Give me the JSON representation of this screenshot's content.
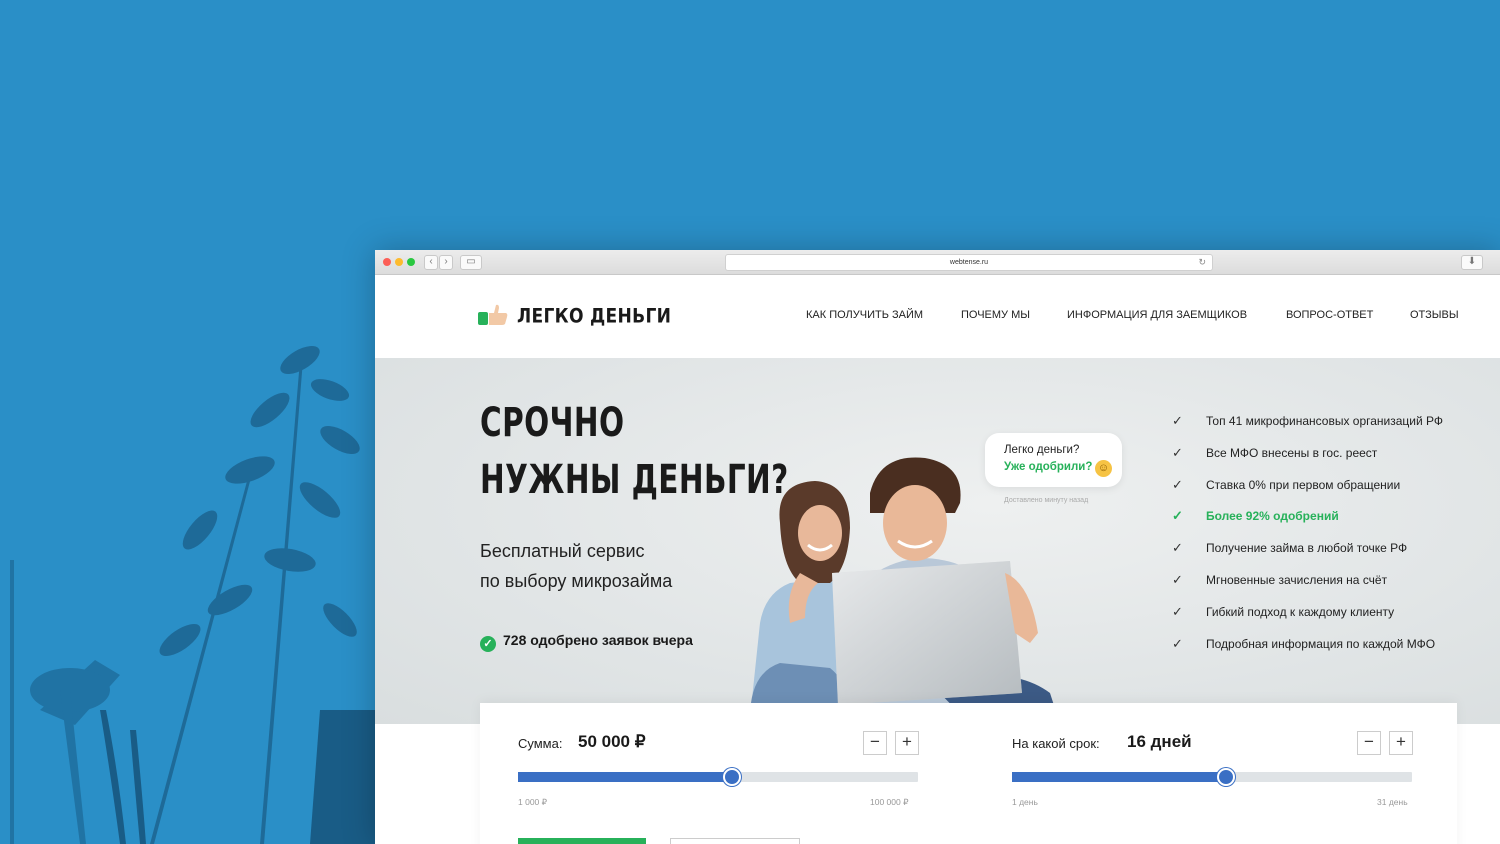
{
  "browser": {
    "url": "webtense.ru"
  },
  "header": {
    "logo_text": "ЛЕГКО ДЕНЬГИ",
    "nav": [
      {
        "label": "КАК ПОЛУЧИТЬ ЗАЙМ"
      },
      {
        "label": "ПОЧЕМУ МЫ"
      },
      {
        "label": "ИНФОРМАЦИЯ ДЛЯ ЗАЕМЩИКОВ"
      },
      {
        "label": "ВОПРОС-ОТВЕТ"
      },
      {
        "label": "ОТЗЫВЫ"
      }
    ]
  },
  "hero": {
    "title_line1": "СРОЧНО",
    "title_line2": "НУЖНЫ ДЕНЬГИ?",
    "subtitle_line1": "Бесплатный сервис",
    "subtitle_line2": "по выбору микрозайма",
    "approved_text": "728 одобрено заявок вчера",
    "bubble_question": "Легко деньги?",
    "bubble_answer": "Уже одобрили?",
    "bubble_delivered": "Доставлено минуту назад",
    "features": [
      {
        "text": "Топ 41 микрофинансовых организаций РФ",
        "highlight": false
      },
      {
        "text": "Все МФО внесены в гос. реест",
        "highlight": false
      },
      {
        "text": "Ставка 0% при первом обращении",
        "highlight": false
      },
      {
        "text": "Более 92% одобрений",
        "highlight": true
      },
      {
        "text": "Получение займа в любой точке РФ",
        "highlight": false
      },
      {
        "text": "Мгновенные зачисления на счёт",
        "highlight": false
      },
      {
        "text": "Гибкий подход к каждому клиенту",
        "highlight": false
      },
      {
        "text": "Подробная информация по каждой МФО",
        "highlight": false
      }
    ]
  },
  "calculator": {
    "amount": {
      "label": "Сумма:",
      "value": "50 000 ₽",
      "min_label": "1 000 ₽",
      "max_label": "100 000 ₽",
      "fill_fraction": 0.535
    },
    "term": {
      "label": "На какой срок:",
      "value": "16 дней",
      "min_label": "1 день",
      "max_label": "31 день",
      "fill_fraction": 0.535
    },
    "minus_symbol": "−",
    "plus_symbol": "+"
  },
  "colors": {
    "accent_green": "#27b15a",
    "slider_blue": "#3a6fc4",
    "background_blue": "#2a8fc7"
  }
}
